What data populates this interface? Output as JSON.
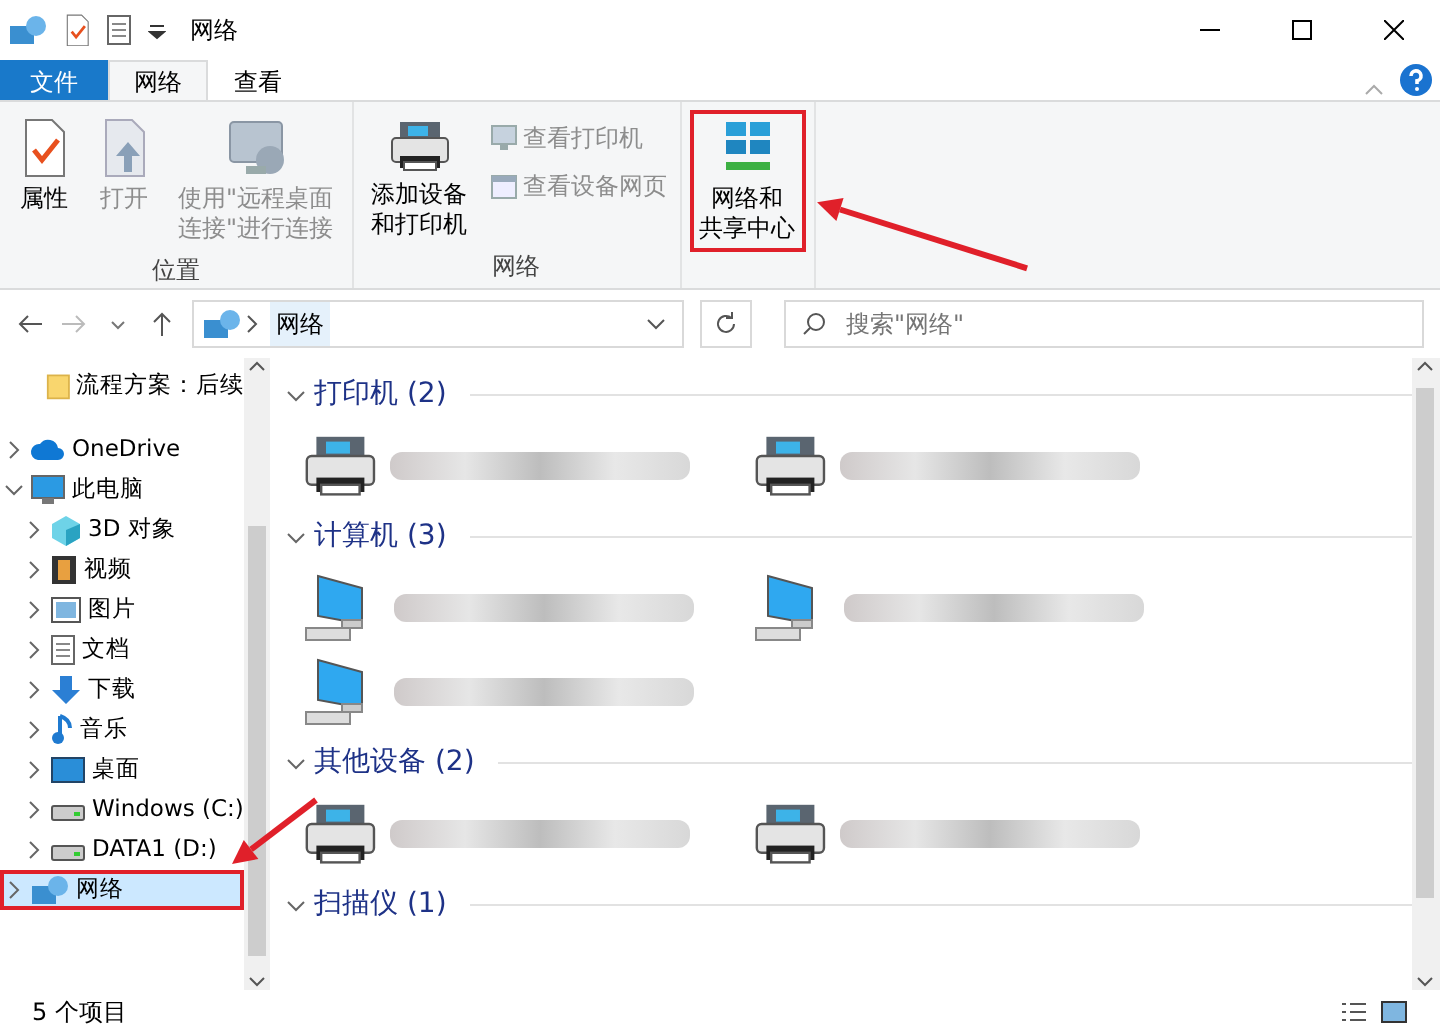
{
  "window": {
    "title": "网络"
  },
  "ribbon_tabs": [
    {
      "label": "文件",
      "kind": "file",
      "selected": false
    },
    {
      "label": "网络",
      "kind": "tab",
      "selected": true
    },
    {
      "label": "查看",
      "kind": "tab",
      "selected": false
    }
  ],
  "ribbon_groups": [
    {
      "label": "位置",
      "buttons": [
        {
          "kind": "large",
          "lines": [
            "属性"
          ],
          "disabled": false
        },
        {
          "kind": "large",
          "lines": [
            "打开"
          ],
          "disabled": true
        },
        {
          "kind": "large",
          "lines": [
            "使用\"远程桌面",
            "连接\"进行连接"
          ],
          "disabled": true
        }
      ]
    },
    {
      "label": "网络",
      "buttons": [
        {
          "kind": "large",
          "lines": [
            "添加设备",
            "和打印机"
          ],
          "disabled": false
        },
        {
          "kind": "small",
          "lines": [
            "查看打印机"
          ],
          "disabled": true
        },
        {
          "kind": "small",
          "lines": [
            "查看设备网页"
          ],
          "disabled": true
        }
      ]
    },
    {
      "buttons": [
        {
          "kind": "large",
          "lines": [
            "网络和",
            "共享中心"
          ],
          "disabled": false,
          "annotated": true
        }
      ]
    }
  ],
  "address": {
    "path": "网络"
  },
  "search": {
    "placeholder": "搜索\"网络\""
  },
  "nav": [
    {
      "label": "流程方案：后续"
    },
    {
      "label": "OneDrive",
      "expanded": false
    },
    {
      "label": "此电脑",
      "expanded": true,
      "children": [
        {
          "label": "3D 对象",
          "expanded": false
        },
        {
          "label": "视频",
          "expanded": false
        },
        {
          "label": "图片",
          "expanded": false
        },
        {
          "label": "文档",
          "expanded": false
        },
        {
          "label": "下载",
          "expanded": false
        },
        {
          "label": "音乐",
          "expanded": false
        },
        {
          "label": "桌面",
          "expanded": false
        },
        {
          "label": "Windows (C:)",
          "expanded": false
        },
        {
          "label": "DATA1 (D:)",
          "expanded": false
        }
      ]
    },
    {
      "label": "网络",
      "expanded": false,
      "selected": true,
      "annotated": true
    }
  ],
  "groups": [
    {
      "header": "打印机 (2)",
      "expanded": true,
      "items": [
        {
          "kind": "printer"
        },
        {
          "kind": "printer"
        }
      ]
    },
    {
      "header": "计算机 (3)",
      "expanded": true,
      "items": [
        {
          "kind": "computer"
        },
        {
          "kind": "computer"
        },
        {
          "kind": "computer"
        }
      ]
    },
    {
      "header": "其他设备 (2)",
      "expanded": true,
      "items": [
        {
          "kind": "printer"
        },
        {
          "kind": "printer"
        }
      ]
    },
    {
      "header": "扫描仪 (1)",
      "expanded": true
    }
  ],
  "status_bar": {
    "count": "5 个项目"
  }
}
